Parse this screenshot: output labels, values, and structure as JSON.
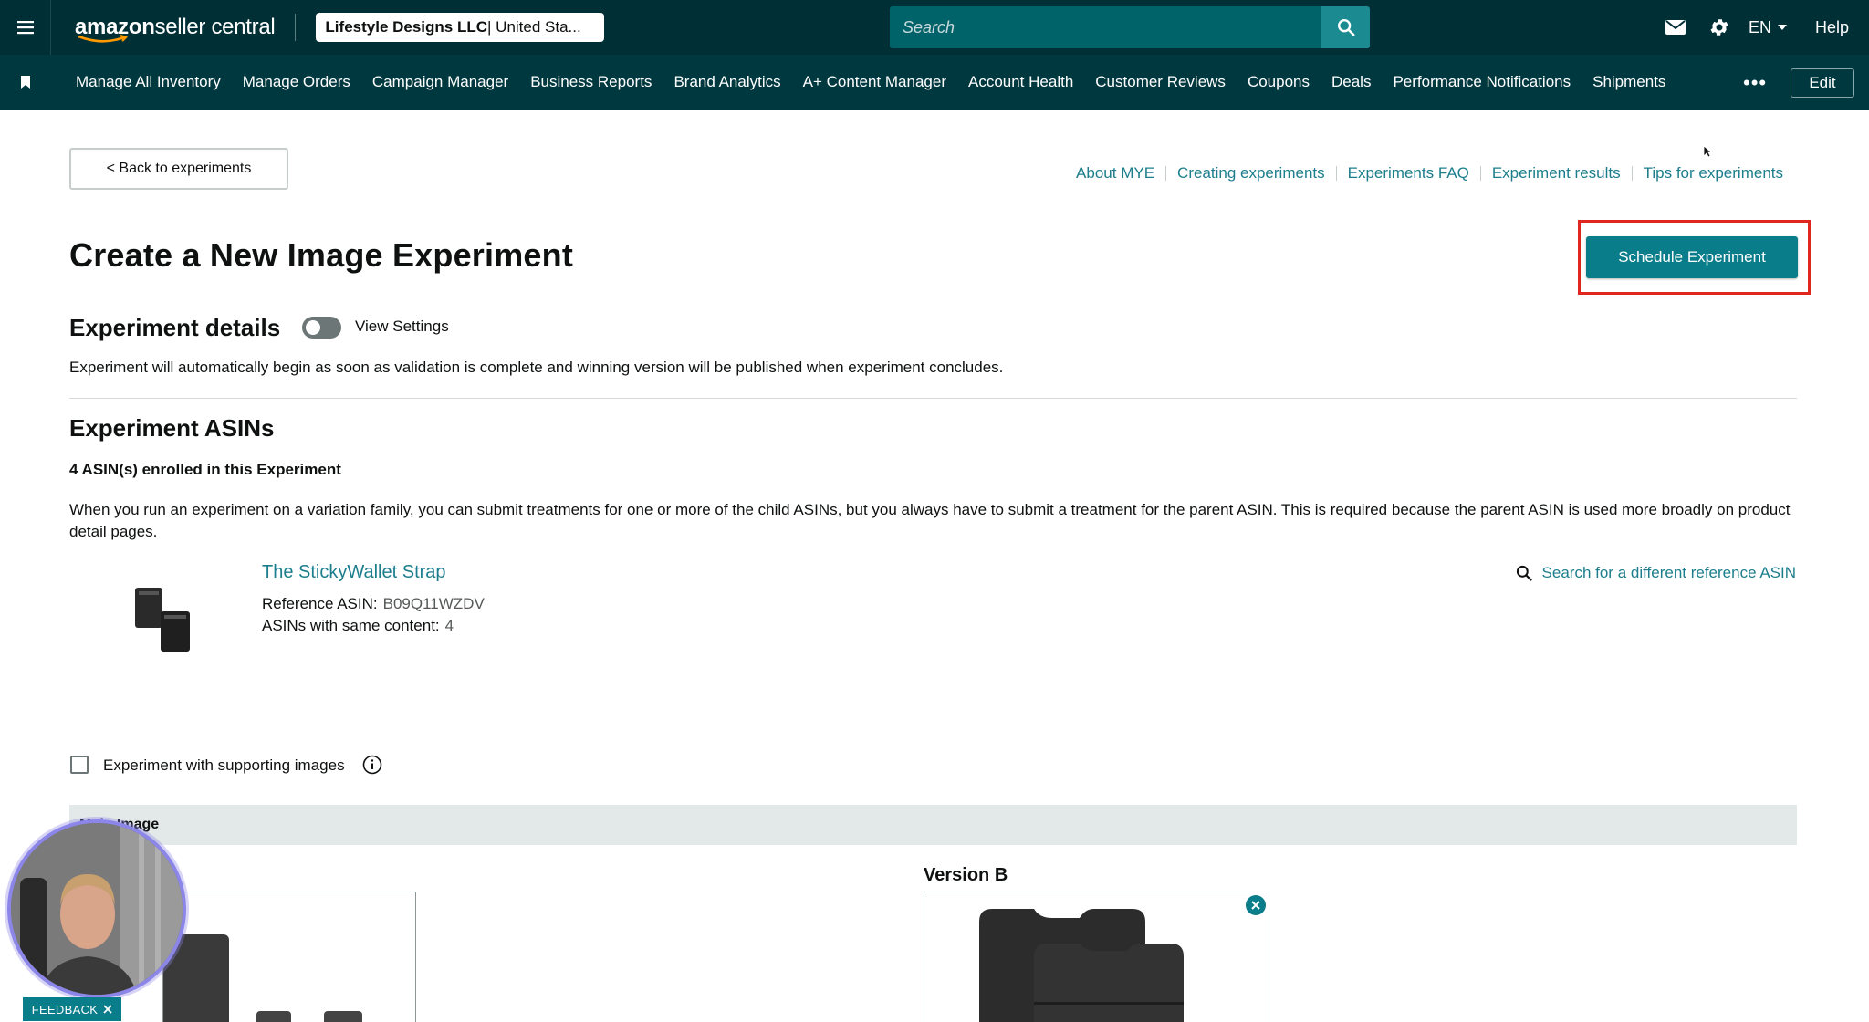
{
  "header": {
    "logo_brand": "amazon",
    "logo_suffix": " seller central",
    "account_bold": "Lifestyle Designs LLC",
    "account_region": " | United Sta...",
    "search_placeholder": "Search",
    "language": "EN",
    "help": "Help"
  },
  "nav": {
    "items": [
      "Manage All Inventory",
      "Manage Orders",
      "Campaign Manager",
      "Business Reports",
      "Brand Analytics",
      "A+ Content Manager",
      "Account Health",
      "Customer Reviews",
      "Coupons",
      "Deals",
      "Performance Notifications",
      "Shipments"
    ],
    "more": "•••",
    "edit": "Edit"
  },
  "page": {
    "back_button": "< Back to experiments",
    "help_links": [
      "About MYE",
      "Creating experiments",
      "Experiments FAQ",
      "Experiment results",
      "Tips for experiments"
    ],
    "title": "Create a New Image Experiment",
    "schedule_button": "Schedule Experiment",
    "details_title": "Experiment details",
    "view_settings": "View Settings",
    "details_text": "Experiment will automatically begin as soon as validation is complete and winning version will be published when experiment concludes.",
    "asins_title": "Experiment ASINs",
    "enrolled": "4 ASIN(s) enrolled in this Experiment",
    "variation_text": "When you run an experiment on a variation family, you can submit treatments for one or more of the child ASINs, but you always have to submit a treatment for the parent ASIN. This is required because the parent ASIN is used more broadly on product detail pages.",
    "product": {
      "title": "The StickyWallet Strap",
      "ref_label": "Reference ASIN:",
      "ref_value": "B09Q11WZDV",
      "same_label": "ASINs with same content:",
      "same_value": "4"
    },
    "search_ref": "Search for a different reference ASIN",
    "supporting_images": "Experiment with supporting images",
    "main_image": "Main Image",
    "version_b": "Version B",
    "feedback": "FEEDBACK"
  },
  "colors": {
    "topbar": "#002f36",
    "navbar": "#00383f",
    "accent": "#097d8a",
    "link": "#1c7e8c",
    "highlight": "#e0271f"
  }
}
